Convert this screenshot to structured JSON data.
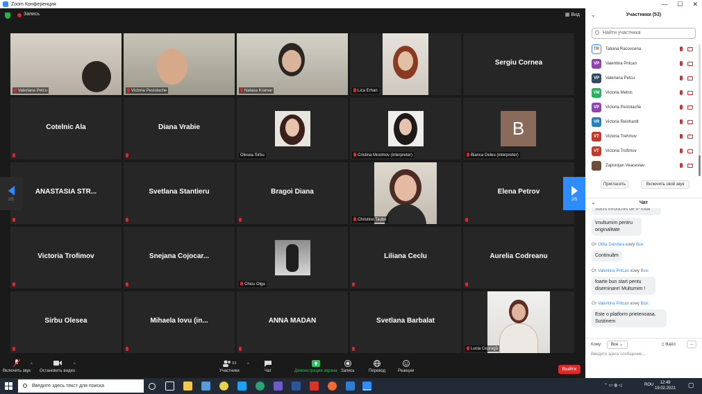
{
  "window": {
    "title": "Zoom Конференция",
    "controls": [
      "—",
      "☐",
      "✕"
    ]
  },
  "meeting": {
    "recording_label": "Запись",
    "view_label": "Вид",
    "page_left": "2/5",
    "page_right": "2/5"
  },
  "tiles": [
    {
      "name": "Valeriana Petcu",
      "kind": "video"
    },
    {
      "name": "Victoria Pestolache",
      "kind": "video"
    },
    {
      "name": "Natasa Kramar",
      "kind": "video"
    },
    {
      "name": "Lica Erhan",
      "kind": "photo"
    },
    {
      "name": "Sergiu Cornea",
      "kind": "name"
    },
    {
      "name": "Cotelnic Ala",
      "kind": "name"
    },
    {
      "name": "Diana Vrabie",
      "kind": "name"
    },
    {
      "name": "Olesea Sirbu",
      "kind": "photo"
    },
    {
      "name": "Cristina Moximov (interpreter)",
      "kind": "photo"
    },
    {
      "name": "Bianca Deleu (interpreter)",
      "kind": "avatar",
      "initial": "B"
    },
    {
      "name": "ANASTASIA  STR...",
      "kind": "name"
    },
    {
      "name": "Svetlana Stantieru",
      "kind": "name"
    },
    {
      "name": "Bragoi Diana",
      "kind": "name"
    },
    {
      "name": "Christine Taube",
      "kind": "photo"
    },
    {
      "name": "Elena Petrov",
      "kind": "name"
    },
    {
      "name": "Victoria Trofimov",
      "kind": "name"
    },
    {
      "name": "Snejana  Cojocar...",
      "kind": "name"
    },
    {
      "name": "Chicu Olga",
      "kind": "photo"
    },
    {
      "name": "Liliana Ceclu",
      "kind": "name"
    },
    {
      "name": "Aurelia Codreanu",
      "kind": "name"
    },
    {
      "name": "Sirbu Olesea",
      "kind": "name"
    },
    {
      "name": "Mihaela  Iovu  (in...",
      "kind": "name"
    },
    {
      "name": "ANNA MADAN",
      "kind": "name"
    },
    {
      "name": "Svetlana Barbalat",
      "kind": "name"
    },
    {
      "name": "Lucia Cepragă",
      "kind": "photo"
    }
  ],
  "toolbar": {
    "unmute": "Включить звук",
    "stop_video": "Остановить видео",
    "participants": "Участники",
    "participants_count": "53",
    "chat": "Чат",
    "share": "Демонстрация экрана",
    "record": "Запись",
    "translate": "Перевод",
    "reactions": "Реакции",
    "leave": "Выйти"
  },
  "participants_panel": {
    "title": "Участники (53)",
    "search_placeholder": "Найти участника",
    "items": [
      {
        "name": "Tatiana Racovcena",
        "initials": "TR",
        "color": "#ffffff"
      },
      {
        "name": "Valentina Pritcan",
        "initials": "VP",
        "color": "#8e44ad"
      },
      {
        "name": "Valeriana Petcu",
        "initials": "VP",
        "color": "#34495e"
      },
      {
        "name": "Victoria Melnic",
        "initials": "VM",
        "color": "#27ae60"
      },
      {
        "name": "Victoria Pestolache",
        "initials": "VP",
        "color": "#8e44ad"
      },
      {
        "name": "Victoria Reinhardt",
        "initials": "VR",
        "color": "#2980b9"
      },
      {
        "name": "Victoria Trehmov",
        "initials": "VT",
        "color": "#c0392b"
      },
      {
        "name": "Victoria Trofimov",
        "initials": "VT",
        "color": "#c0392b"
      },
      {
        "name": "Zaporojan Veaceslav",
        "initials": "",
        "color": "#6b4f3a"
      }
    ],
    "invite": "Пригласить",
    "unmute_me": "Включить свой звук"
  },
  "chat": {
    "title": "Чат",
    "messages": [
      {
        "from": "",
        "to": "",
        "text": "Sucis inrouchis de x-Totai"
      },
      {
        "from": "",
        "to": "",
        "text": "\\multumim pentru originalitate"
      },
      {
        "from": "Otilia Dandara",
        "to": "Все:",
        "text": "Continuăm"
      },
      {
        "from": "Valentina Pritcan",
        "to": "Все:",
        "text": "foarte bun start pentu diseminare! Multumim !"
      },
      {
        "from": "Valentina Pritcan",
        "to": "Все:",
        "text": "Este o platform prietenoasa. Sustinem"
      }
    ],
    "from_prefix": "От",
    "to_word": "кому",
    "to_label": "Кому:",
    "to_value": "Все",
    "file": "Файл",
    "more": "...",
    "input_placeholder": "Введите здесь сообщение..."
  },
  "taskbar": {
    "search_placeholder": "Введите здесь текст для поиска",
    "lang": "ROU",
    "time": "12:49",
    "date": "19.02.2021"
  }
}
